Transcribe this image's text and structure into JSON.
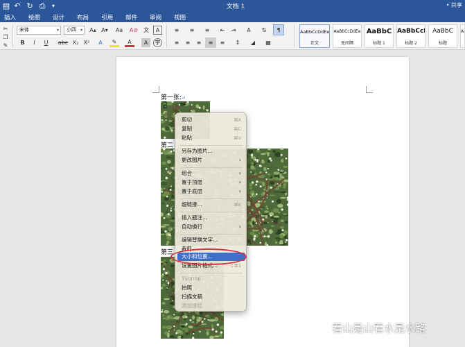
{
  "titlebar": {
    "doc_title": "文档 1",
    "share_label": "• 共享"
  },
  "tabs": [
    "插入",
    "绘图",
    "设计",
    "布局",
    "引用",
    "邮件",
    "审阅",
    "视图"
  ],
  "ribbon": {
    "font_name": "宋体",
    "font_size": "小四",
    "grow_font": "A▴",
    "shrink_font": "A▾",
    "clear_format": "A⊘",
    "pinyin": "文",
    "char_border": "A",
    "bold": "B",
    "italic": "I",
    "underline": "U",
    "strike": "abc",
    "subscript": "X₂",
    "superscript": "X²",
    "text_effect": "A",
    "highlight": "✎",
    "font_color": "A",
    "char_shading": "A",
    "enclosed": "字"
  },
  "styles": [
    {
      "preview": "AaBbCcDdEe",
      "name": "正文"
    },
    {
      "preview": "AaBbCcDdEe",
      "name": "无间隔"
    },
    {
      "preview": "AaBbC",
      "name": "标题 1"
    },
    {
      "preview": "AaBbCcI",
      "name": "标题 2"
    },
    {
      "preview": "AaBbC",
      "name": "标题"
    },
    {
      "preview": "AaBbCcDd",
      "name": ""
    }
  ],
  "document": {
    "captions": [
      "第一张:",
      "第二",
      "第三"
    ],
    "para_mark": "↵"
  },
  "context_menu": [
    {
      "label": "剪切",
      "shortcut": "⌘X"
    },
    {
      "label": "复制",
      "shortcut": "⌘C"
    },
    {
      "label": "粘贴",
      "shortcut": "⌘V"
    },
    {
      "label": "另存为图片..."
    },
    {
      "label": "更改图片",
      "submenu": true
    },
    {
      "label": "组合",
      "submenu": true
    },
    {
      "label": "置于顶层",
      "submenu": true
    },
    {
      "label": "置于底层",
      "submenu": true
    },
    {
      "label": "超链接...",
      "shortcut": "⌘K"
    },
    {
      "label": "插入题注..."
    },
    {
      "label": "自动换行",
      "submenu": true
    },
    {
      "label": "编辑替换文字..."
    },
    {
      "label": "裁剪"
    },
    {
      "label": "大小和位置...",
      "highlighted": true
    },
    {
      "label": "设置图片格式...",
      "shortcut": "⇧⌘1"
    },
    {
      "label": "Yvonne",
      "disabled": true
    },
    {
      "label": "拍照"
    },
    {
      "label": "扫描文稿"
    },
    {
      "label": "添加速结",
      "disabled": true
    }
  ],
  "watermark": "看山是山看水是水路",
  "colors": {
    "ribbon_blue": "#2b579a",
    "highlight": "#3f6fc8",
    "annotation_red": "#d8323c"
  }
}
